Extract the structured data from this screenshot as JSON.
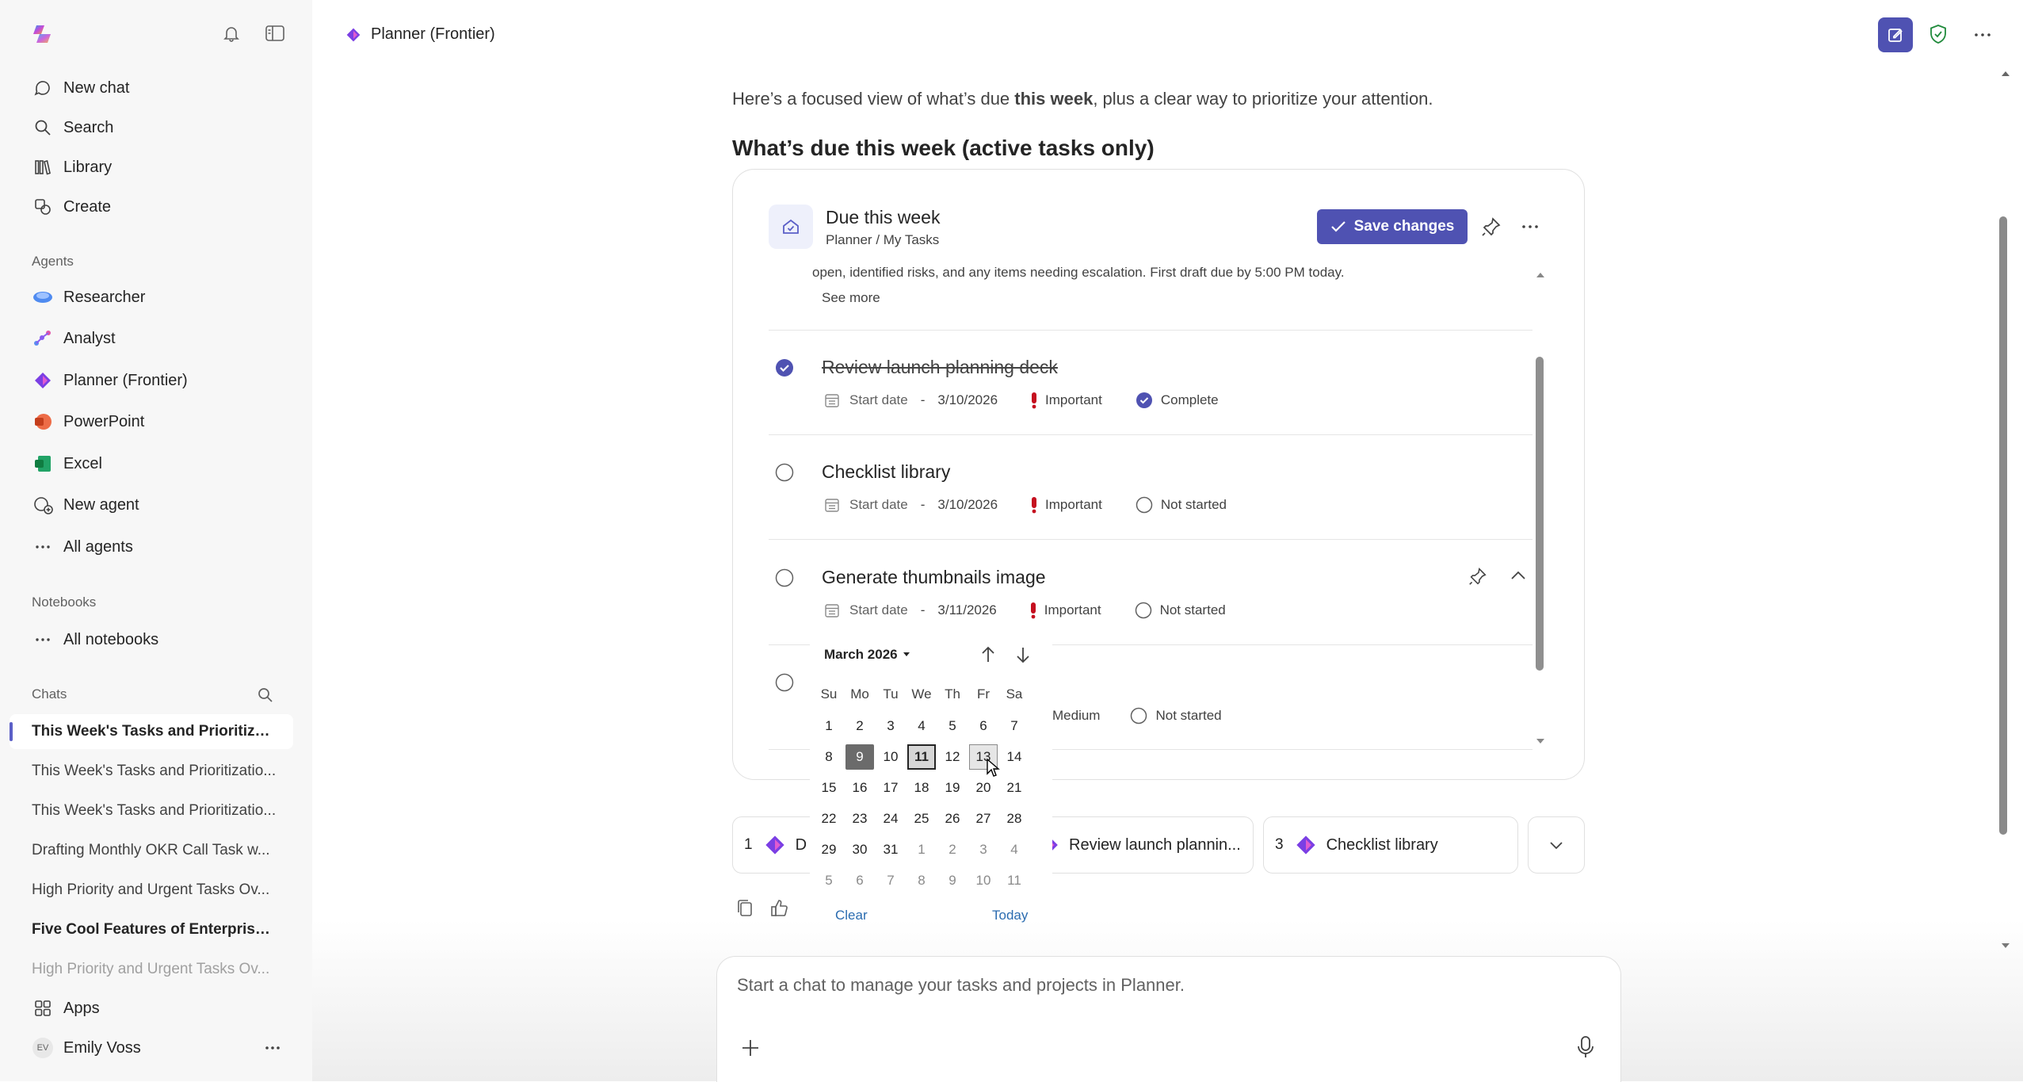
{
  "header": {
    "app_title": "Planner (Frontier)"
  },
  "sidebar": {
    "nav": [
      {
        "label": "New chat",
        "icon": "chat-icon"
      },
      {
        "label": "Search",
        "icon": "search-icon"
      },
      {
        "label": "Library",
        "icon": "library-icon"
      },
      {
        "label": "Create",
        "icon": "create-icon"
      }
    ],
    "agents_heading": "Agents",
    "agents": [
      {
        "label": "Researcher",
        "icon": "researcher-icon",
        "color": "#4f8bf0"
      },
      {
        "label": "Analyst",
        "icon": "analyst-icon",
        "color": "#7a5cf0"
      },
      {
        "label": "Planner (Frontier)",
        "icon": "planner-icon",
        "color": "#7b3fe4"
      },
      {
        "label": "PowerPoint",
        "icon": "powerpoint-icon",
        "color": "#d35230"
      },
      {
        "label": "Excel",
        "icon": "excel-icon",
        "color": "#1d7a45"
      },
      {
        "label": "New agent",
        "icon": "new-agent-icon"
      },
      {
        "label": "All agents",
        "icon": "more-icon"
      }
    ],
    "notebooks_heading": "Notebooks",
    "all_notebooks": "All notebooks",
    "chats_heading": "Chats",
    "chats": [
      "This Week's Tasks and Prioritizati...",
      "This Week's Tasks and Prioritizatio...",
      "This Week's Tasks and Prioritizatio...",
      "Drafting Monthly OKR Call Task w...",
      "High Priority and Urgent Tasks Ov...",
      "Five Cool Features of Enterprise ...",
      "High Priority and Urgent Tasks Ov..."
    ],
    "apps": "Apps",
    "user_initials": "EV",
    "user_name": "Emily Voss"
  },
  "main": {
    "intro_pre": "Here’s a focused view of what’s due ",
    "intro_bold": "this week",
    "intro_post": ", plus a clear way to prioritize your attention.",
    "section_title": "What’s due this week (active tasks only)",
    "card": {
      "title": "Due this week",
      "subtitle": "Planner / My Tasks",
      "save_label": "Save changes",
      "description": "open, identified risks, and any items needing escalation. First draft due by 5:00 PM today.",
      "see_more": "See more",
      "tasks": [
        {
          "title": "Review launch planning deck",
          "start": "Start date",
          "dash": "-",
          "due": "3/10/2026",
          "priority": "Important",
          "status": "Complete",
          "done": true
        },
        {
          "title": "Checklist library",
          "start": "Start date",
          "dash": "-",
          "due": "3/10/2026",
          "priority": "Important",
          "status": "Not started",
          "done": false
        },
        {
          "title": "Generate thumbnails image",
          "start": "Start date",
          "dash": "-",
          "due": "3/11/2026",
          "priority": "Important",
          "status": "Not started",
          "done": false
        },
        {
          "priority": "Medium",
          "status": "Not started",
          "done": false
        }
      ]
    },
    "calendar": {
      "month_label": "March 2026",
      "weekdays": [
        "Su",
        "Mo",
        "Tu",
        "We",
        "Th",
        "Fr",
        "Sa"
      ],
      "weeks": [
        [
          "1",
          "2",
          "3",
          "4",
          "5",
          "6",
          "7"
        ],
        [
          "8",
          "9",
          "10",
          "11",
          "12",
          "13",
          "14"
        ],
        [
          "15",
          "16",
          "17",
          "18",
          "19",
          "20",
          "21"
        ],
        [
          "22",
          "23",
          "24",
          "25",
          "26",
          "27",
          "28"
        ],
        [
          "29",
          "30",
          "31",
          "1",
          "2",
          "3",
          "4"
        ],
        [
          "5",
          "6",
          "7",
          "8",
          "9",
          "10",
          "11"
        ]
      ],
      "selected_day": "9",
      "today_day": "11",
      "hover_day": "13",
      "clear_label": "Clear",
      "today_label": "Today"
    },
    "sources": [
      {
        "num": "1",
        "label": "D"
      },
      {
        "num": "2",
        "label": "Review launch plannin..."
      },
      {
        "num": "3",
        "label": "Checklist library"
      }
    ],
    "composer_placeholder": "Start a chat to manage your tasks and projects in Planner."
  },
  "colors": {
    "accent": "#4f52b2",
    "priority_red": "#c50f1f",
    "sidebar_bg": "#f7f7f7"
  }
}
